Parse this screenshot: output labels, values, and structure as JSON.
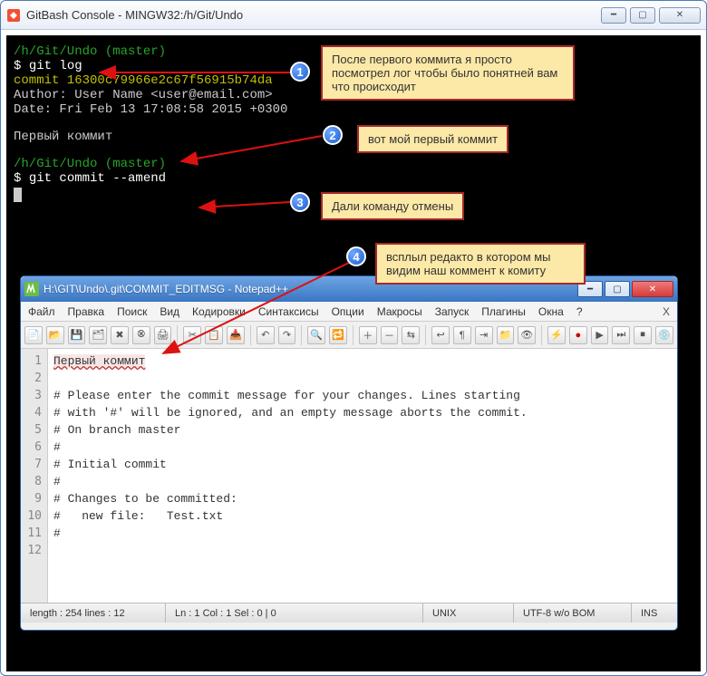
{
  "gitbash": {
    "title": "GitBash Console - MINGW32:/h/Git/Undo",
    "path1": "/h/Git/Undo (master)",
    "cmd1_prompt": "$ ",
    "cmd1": "git log",
    "commit_line": "commit 16300c79966e2c67f56915b74da",
    "author_line": "Author: User Name <user@email.com>",
    "date_line": "Date:   Fri Feb 13 17:08:58 2015 +0300",
    "msg_line": "    Первый коммит",
    "path2": "/h/Git/Undo (master)",
    "cmd2_prompt": "$ ",
    "cmd2": "git commit --amend"
  },
  "badges": {
    "b1": "1",
    "b2": "2",
    "b3": "3",
    "b4": "4"
  },
  "callouts": {
    "c1": "После первого коммита я просто посмотрел лог чтобы было понятней вам что происходит",
    "c2": "вот мой первый коммит",
    "c3": "Дали команду отмены",
    "c4": "всплыл редакто в котором мы видим наш коммент к комиту"
  },
  "npp": {
    "title": "H:\\GIT\\Undo\\.git\\COMMIT_EDITMSG - Notepad++",
    "menu": [
      "Файл",
      "Правка",
      "Поиск",
      "Вид",
      "Кодировки",
      "Синтаксисы",
      "Опции",
      "Макросы",
      "Запуск",
      "Плагины",
      "Окна",
      "?"
    ],
    "menu_x": "X",
    "lines": [
      "Первый коммит",
      "",
      "# Please enter the commit message for your changes. Lines starting",
      "# with '#' will be ignored, and an empty message aborts the commit.",
      "# On branch master",
      "#",
      "# Initial commit",
      "#",
      "# Changes to be committed:",
      "#   new file:   Test.txt",
      "#",
      ""
    ],
    "status": {
      "len": "length : 254    lines : 12",
      "pos": "Ln : 1    Col : 1    Sel : 0 | 0",
      "eol": "UNIX",
      "enc": "UTF-8 w/o BOM",
      "mode": "INS"
    }
  }
}
